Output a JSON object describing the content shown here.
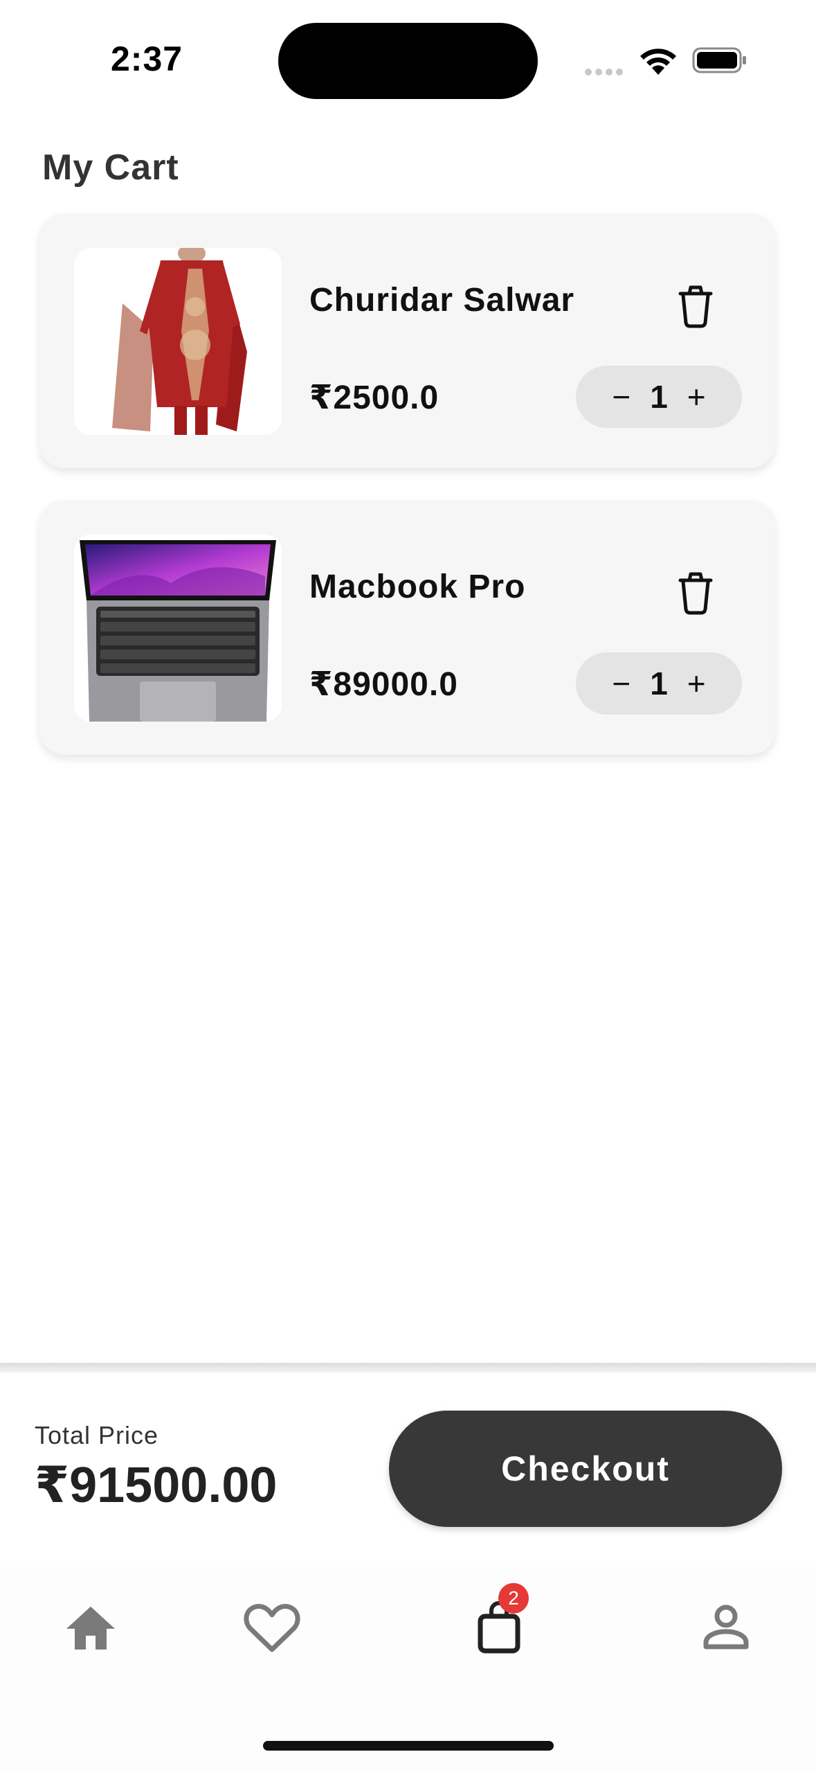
{
  "status_bar": {
    "time": "2:37"
  },
  "page": {
    "title": "My Cart"
  },
  "cart_items": [
    {
      "name": "Churidar Salwar",
      "price": "₹2500.0",
      "quantity": "1",
      "image_icon": "churidar-salwar-image"
    },
    {
      "name": "Macbook Pro",
      "price": "₹89000.0",
      "quantity": "1",
      "image_icon": "macbook-pro-image"
    }
  ],
  "stepper": {
    "decrement": "−",
    "increment": "+"
  },
  "summary": {
    "total_label": "Total Price",
    "total_value": "₹91500.00",
    "checkout_label": "Checkout"
  },
  "bottom_nav": {
    "items": [
      {
        "icon": "home-icon"
      },
      {
        "icon": "heart-icon"
      },
      {
        "icon": "shopping-bag-icon",
        "badge": "2"
      },
      {
        "icon": "person-icon"
      }
    ]
  },
  "colors": {
    "accent": "#383838",
    "badge": "#e53935",
    "card_bg": "#f6f6f6",
    "stepper_bg": "#e4e4e4",
    "nav_icon": "#7a7a7a"
  }
}
